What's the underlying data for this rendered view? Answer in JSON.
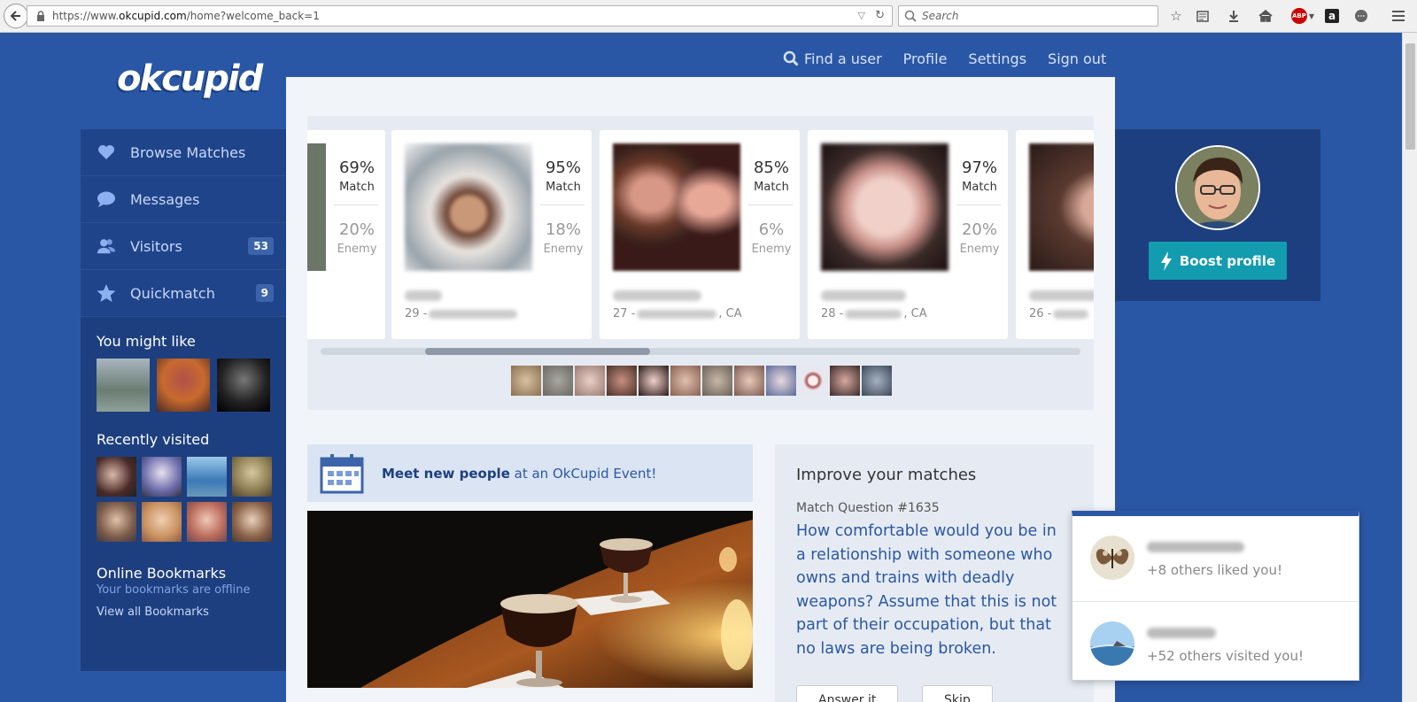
{
  "browser": {
    "url_prefix": "https://www.",
    "url_domain": "okcupid.com",
    "url_path": "/home?welcome_back=1",
    "search_placeholder": "Search",
    "abp_label": "ABP",
    "amazon_label": "a"
  },
  "logo": "okcupid",
  "topnav": {
    "find_user": "Find a user",
    "profile": "Profile",
    "settings": "Settings",
    "sign_out": "Sign out"
  },
  "sidebar": {
    "items": [
      {
        "label": "Browse Matches",
        "icon": "heart-icon"
      },
      {
        "label": "Messages",
        "icon": "chat-bubble-icon"
      },
      {
        "label": "Visitors",
        "icon": "people-icon",
        "badge": "53"
      },
      {
        "label": "Quickmatch",
        "icon": "star-icon",
        "badge": "9"
      }
    ],
    "you_might_like": "You might like",
    "recently_visited": "Recently visited",
    "online_bookmarks": "Online Bookmarks",
    "bookmarks_offline": "Your bookmarks are offline",
    "view_all_bookmarks": "View all Bookmarks"
  },
  "carousel": {
    "cards": [
      {
        "match": "69%",
        "enemy": "20%",
        "age": "",
        "location": ""
      },
      {
        "match": "95%",
        "enemy": "18%",
        "age": "29 -",
        "location": ""
      },
      {
        "match": "85%",
        "enemy": "6%",
        "age": "27 -",
        "location": ", CA"
      },
      {
        "match": "97%",
        "enemy": "20%",
        "age": "28 -",
        "location": ", CA"
      },
      {
        "match": "",
        "enemy": "",
        "age": "26 -",
        "location": ""
      }
    ],
    "match_label": "Match",
    "enemy_label": "Enemy"
  },
  "event": {
    "bold": "Meet new people",
    "rest": " at an OkCupid Event!"
  },
  "improve": {
    "title": "Improve your matches",
    "question_number": "Match Question #1635",
    "question": "How comfortable would you be in a relationship with someone who owns and trains with deadly weapons? Assume that this is not part of their occupation, but that no laws are being broken.",
    "answer_button": "Answer it",
    "skip_button": "Skip"
  },
  "profile_box": {
    "boost": "Boost profile"
  },
  "notifications": [
    {
      "text": "+8 others liked you!"
    },
    {
      "text": "+52 others visited you!"
    }
  ]
}
